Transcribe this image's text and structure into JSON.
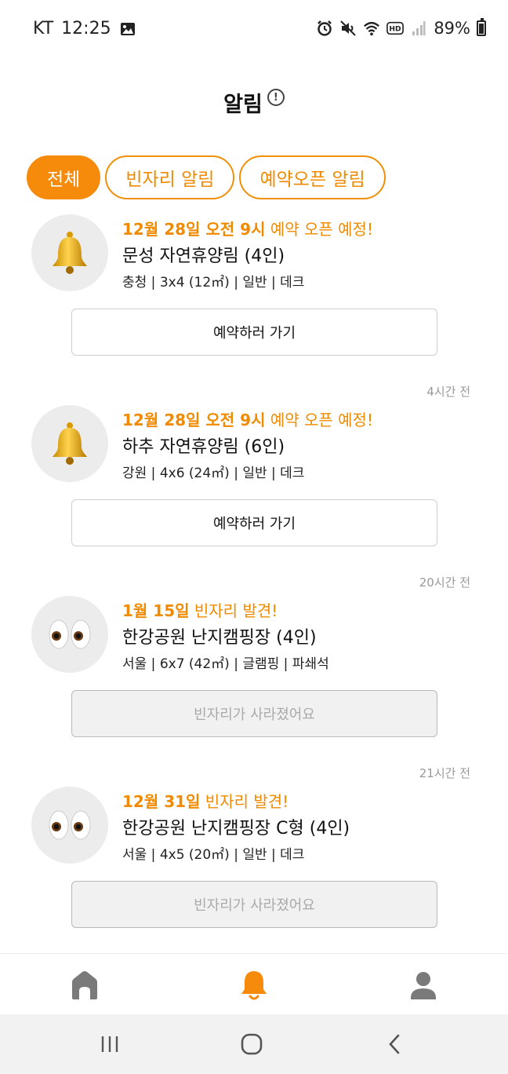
{
  "status_bar": {
    "carrier": "KT",
    "time": "12:25",
    "battery": "89%",
    "icons": [
      "image-icon",
      "alarm-icon",
      "mute-icon",
      "wifi-icon",
      "hd-icon",
      "signal-icon",
      "battery-icon"
    ]
  },
  "header": {
    "title": "알림",
    "info_icon": "!"
  },
  "tabs": [
    {
      "label": "전체",
      "active": true
    },
    {
      "label": "빈자리 알림",
      "active": false
    },
    {
      "label": "예약오픈 알림",
      "active": false
    }
  ],
  "notifications": [
    {
      "timestamp": "",
      "icon": "bell-emoji",
      "emoji": "🔔",
      "head_highlight": "12월 28일 오전 9시",
      "head_rest": " 예약 오픈 예정!",
      "title": "문성 자연휴양림 (4인)",
      "meta": "충청 | 3x4 (12㎡) | 일반 | 데크",
      "button": "예약하러 가기",
      "button_disabled": false
    },
    {
      "timestamp": "4시간 전",
      "icon": "bell-emoji",
      "emoji": "🔔",
      "head_highlight": "12월 28일 오전 9시",
      "head_rest": " 예약 오픈 예정!",
      "title": "하추 자연휴양림 (6인)",
      "meta": "강원 | 4x6 (24㎡) | 일반 | 데크",
      "button": "예약하러 가기",
      "button_disabled": false
    },
    {
      "timestamp": "20시간 전",
      "icon": "eyes-emoji",
      "emoji": "👀",
      "head_highlight": "1월 15일",
      "head_rest": " 빈자리 발견!",
      "title": "한강공원 난지캠핑장 (4인)",
      "meta": "서울 | 6x7 (42㎡) | 글램핑 | 파쇄석",
      "button": "빈자리가 사라졌어요",
      "button_disabled": true
    },
    {
      "timestamp": "21시간 전",
      "icon": "eyes-emoji",
      "emoji": "👀",
      "head_highlight": "12월 31일",
      "head_rest": " 빈자리 발견!",
      "title": "한강공원 난지캠핑장 C형 (4인)",
      "meta": "서울 | 4x5 (20㎡) | 일반 | 데크",
      "button": "빈자리가 사라졌어요",
      "button_disabled": true
    }
  ],
  "bottom_nav": [
    {
      "icon": "home-icon",
      "active": false
    },
    {
      "icon": "bell-icon",
      "active": true
    },
    {
      "icon": "profile-icon",
      "active": false
    }
  ],
  "colors": {
    "accent": "#f68a0a",
    "inactive_icon": "#7a7a7a",
    "disabled_bg": "#f1f1f1"
  }
}
